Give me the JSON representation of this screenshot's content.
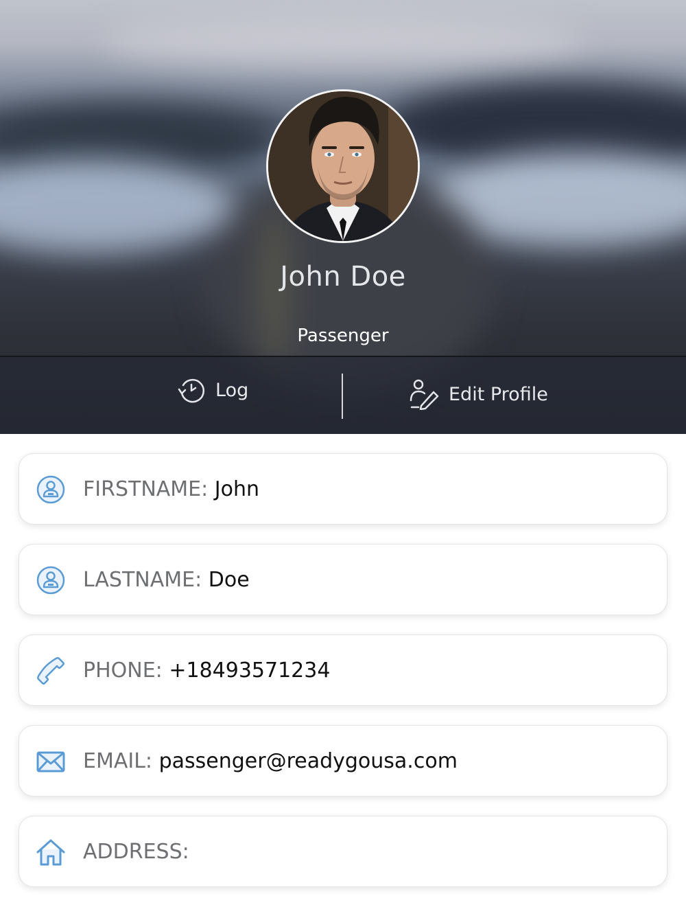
{
  "profile": {
    "name": "John Doe",
    "role": "Passenger"
  },
  "actions": {
    "log_label": "Log",
    "edit_label": "Edit Profile"
  },
  "fields": [
    {
      "label": "FIRSTNAME:",
      "value": "John",
      "icon": "user-badge-icon"
    },
    {
      "label": "LASTNAME:",
      "value": "Doe",
      "icon": "user-badge-icon"
    },
    {
      "label": "PHONE:",
      "value": "+18493571234",
      "icon": "phone-icon"
    },
    {
      "label": "EMAIL:",
      "value": "passenger@readygousa.com",
      "icon": "envelope-icon"
    },
    {
      "label": "ADDRESS:",
      "value": "",
      "icon": "home-icon"
    }
  ],
  "colors": {
    "icon_blue": "#5b9bd5",
    "label_gray": "#6e6f73",
    "value_black": "#111111"
  }
}
